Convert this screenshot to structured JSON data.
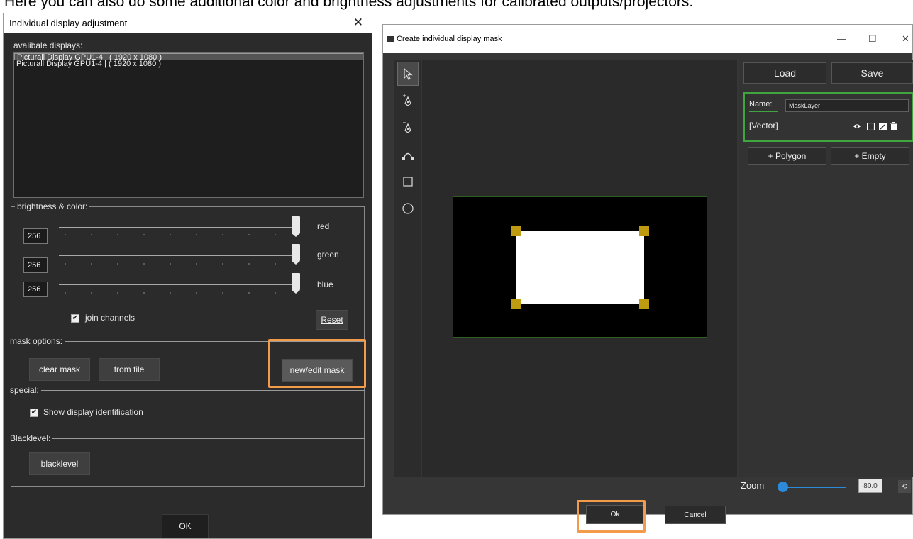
{
  "caption": "Here you can also do some additional color and brightness adjustments for calibrated outputs/projectors:",
  "left_window": {
    "title": "Individual display adjustment",
    "close_glyph": "✕",
    "displays_label": "avalibale displays:",
    "displays": [
      "Picturall Display GPU1-4 | ( 1920 x 1080 )",
      "Picturall Display GPU1-4 | ( 1920 x 1080 )"
    ],
    "brightness_group": "brightness & color:",
    "channels": [
      {
        "value": "256",
        "label": "red",
        "level": 1.0
      },
      {
        "value": "256",
        "label": "green",
        "level": 1.0
      },
      {
        "value": "256",
        "label": "blue",
        "level": 1.0
      }
    ],
    "join_channels": "join channels",
    "join_checked": true,
    "reset": "Reset",
    "mask_group": "mask options:",
    "clear_mask": "clear mask",
    "from_file": "from file",
    "new_edit_mask": "new/edit mask",
    "special_group": "special:",
    "show_display_id": "Show display identification",
    "show_display_id_checked": true,
    "blacklevel_group": "Blacklevel:",
    "blacklevel_button": "blacklevel",
    "ok": "OK"
  },
  "right_window": {
    "title": "Create individual display mask",
    "minimize_glyph": "—",
    "maximize_glyph": "☐",
    "close_glyph": "✕",
    "tools": [
      "select-arrow",
      "pen-add",
      "pen-remove",
      "curve",
      "rectangle",
      "circle"
    ],
    "load": "Load",
    "save": "Save",
    "name_label": "Name:",
    "name_value": "MaskLayer",
    "layer_type": "[Vector]",
    "add_polygon": "+ Polygon",
    "add_empty": "+ Empty",
    "zoom_label": "Zoom",
    "zoom_value": "80.0",
    "ok": "Ok",
    "cancel": "Cancel"
  },
  "colors": {
    "highlight": "#f39a4b",
    "layer_border": "#3fa53f",
    "handle": "#bf9b12",
    "zoom_accent": "#2d8ad8"
  }
}
